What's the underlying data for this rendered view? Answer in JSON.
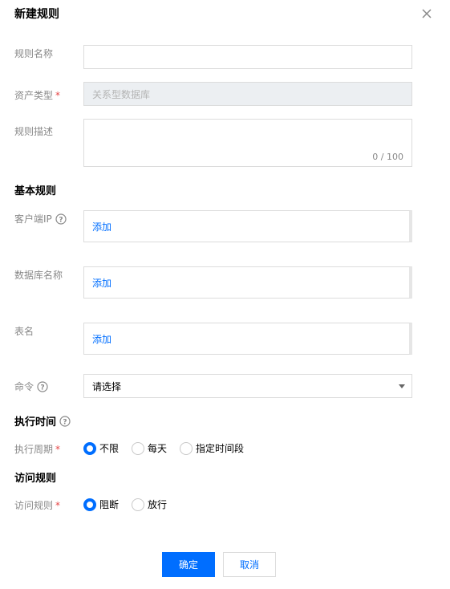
{
  "dialog": {
    "title": "新建规则"
  },
  "fields": {
    "rule_name_label": "规则名称",
    "asset_type_label": "资产类型",
    "asset_type_value": "关系型数据库",
    "rule_desc_label": "规则描述",
    "rule_desc_count": "0 / 100",
    "required_mark": "*"
  },
  "basic": {
    "section_title": "基本规则",
    "client_ip_label": "客户端IP",
    "db_name_label": "数据库名称",
    "table_label": "表名",
    "add_label": "添加",
    "command_label": "命令",
    "command_placeholder": "请选择"
  },
  "exec_time": {
    "section_title": "执行时间",
    "period_label": "执行周期",
    "options": [
      "不限",
      "每天",
      "指定时间段"
    ],
    "selected": "不限"
  },
  "access": {
    "section_title": "访问规则",
    "rule_label": "访问规则",
    "options": [
      "阻断",
      "放行"
    ],
    "selected": "阻断"
  },
  "footer": {
    "confirm_label": "确定",
    "cancel_label": "取消"
  },
  "colors": {
    "primary": "#006eff",
    "required": "#e54545"
  }
}
